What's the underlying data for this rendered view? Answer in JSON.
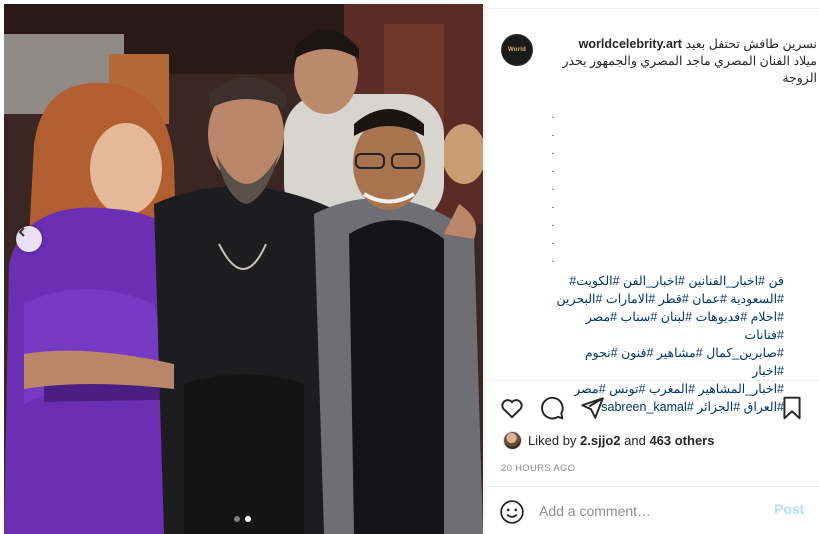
{
  "post": {
    "username": "worldcelebrity.art",
    "avatar_text": "World",
    "caption_title_line1": "نسرين طافش تحتفل بعيد",
    "caption_title_line2": "ميلاد الفنان المصري ماجد المصري والجمهور يحذر",
    "caption_title_line3": "الزوجة",
    "caption_dots": [
      ".",
      ".",
      ".",
      ".",
      ".",
      ".",
      ".",
      ".",
      "."
    ],
    "hashtags_lines": [
      "فن #اخبار_الفنانين #اخبار_الفن #الكويت#",
      "#السعودية #عمان #قطر #الامارات #البحرين",
      "#احلام #فديوهات #لبنان #سناب #مصر #فنانات",
      "#صابرين_كمال #مشاهير #فنون #نجوم #اخبار",
      "#اخبار_المشاهير #المغرب #تونس #مصر",
      "#العراق #الجزائر #sabreen_kamal"
    ]
  },
  "icons": {
    "like": "heart-icon",
    "comment": "comment-icon",
    "share": "share-icon",
    "save": "bookmark-icon",
    "emoji": "emoji-icon",
    "prev": "chevron-left-icon"
  },
  "engagement": {
    "liked_by_prefix": "Liked by ",
    "liked_by_user": "2.sjjo2",
    "liked_by_middle": " and ",
    "liked_by_others": "463 others",
    "timestamp": "20 HOURS AGO"
  },
  "comment": {
    "placeholder": "Add a comment…",
    "post_label": "Post"
  },
  "carousel": {
    "slides": 2,
    "active_index": 1
  },
  "colors": {
    "link": "#00376b",
    "muted": "#8e8e8e",
    "post_button_disabled": "#b2dffc",
    "dress": "#6a2fb3"
  }
}
